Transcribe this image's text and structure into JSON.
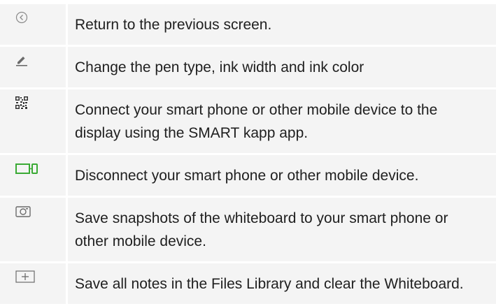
{
  "rows": [
    {
      "icon": "back-circle-icon",
      "text": "Return to the previous screen."
    },
    {
      "icon": "pen-icon",
      "text": "Change the pen type, ink width and ink color"
    },
    {
      "icon": "qr-code-icon",
      "text": "Connect your smart phone or other mobile device to the display using the SMART kapp app."
    },
    {
      "icon": "disconnect-device-icon",
      "text": "Disconnect your smart phone or other mobile device."
    },
    {
      "icon": "camera-icon",
      "text": "Save snapshots of the whiteboard to your smart phone or other mobile device."
    },
    {
      "icon": "save-clear-icon",
      "text": "Save all notes in the Files Library and clear the Whiteboard."
    }
  ],
  "colors": {
    "row_background": "#f4f4f4",
    "icon_gray": "#6b6b6b",
    "icon_green": "#3aaa35",
    "text": "#1f1f1f"
  }
}
